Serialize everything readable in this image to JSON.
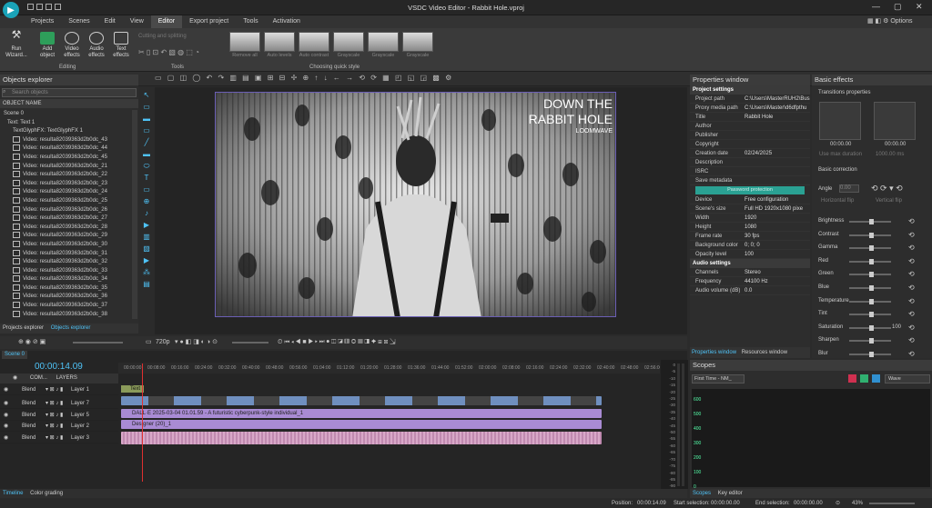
{
  "window": {
    "title": "VSDC Video Editor - Rabbit Hole.vproj",
    "options": "Options"
  },
  "menu": [
    "Projects",
    "Scenes",
    "Edit",
    "View",
    "Editor",
    "Export project",
    "Tools",
    "Activation"
  ],
  "ribbon": {
    "run": "Run Wizard...",
    "add": "Add object",
    "video": "Video effects",
    "audio": "Audio effects",
    "text": "Text effects",
    "editing": "Editing",
    "cutting": "Cutting and splitting",
    "tools": "Tools",
    "choosing": "Choosing quick style",
    "styles": [
      "Remove all",
      "Auto levels",
      "Auto contrast",
      "Grayscale",
      "Grayscale",
      "Grayscale"
    ]
  },
  "objects_explorer": {
    "title": "Objects explorer",
    "search_placeholder": "Search objects",
    "col": "OBJECT NAME",
    "scene": "Scene 0",
    "text": "Text: Text 1",
    "glyph": "TextGlyphFX: TextGlyphFX 1",
    "videos": [
      "Video: resulta82039363d2b0dc_43",
      "Video: resulta82039363d2b0dc_44",
      "Video: resulta82039363d2b0dc_45",
      "Video: resulta82039363d2b0dc_21",
      "Video: resulta82039363d2b0dc_22",
      "Video: resulta82039363d2b0dc_23",
      "Video: resulta82039363d2b0dc_24",
      "Video: resulta82039363d2b0dc_25",
      "Video: resulta82039363d2b0dc_26",
      "Video: resulta82039363d2b0dc_27",
      "Video: resulta82039363d2b0dc_28",
      "Video: resulta82039363d2b0dc_29",
      "Video: resulta82039363d2b0dc_30",
      "Video: resulta82039363d2b0dc_31",
      "Video: resulta82039363d2b0dc_32",
      "Video: resulta82039363d2b0dc_33",
      "Video: resulta82039363d2b0dc_34",
      "Video: resulta82039363d2b0dc_35",
      "Video: resulta82039363d2b0dc_36",
      "Video: resulta82039363d2b0dc_37",
      "Video: resulta82039363d2b0dc_38"
    ],
    "tabs": [
      "Projects explorer",
      "Objects explorer"
    ]
  },
  "preview": {
    "title_line1": "DOWN THE",
    "title_line2": "RABBIT HOLE",
    "brand": "LOOMWAVE",
    "quality": "720p"
  },
  "properties": {
    "title": "Properties window",
    "section": "Project settings",
    "rows": [
      [
        "Project path",
        "C:\\Users\\MasterRUH2\\Busin"
      ],
      [
        "Proxy media path",
        "C:\\Users\\Master\\d6dfpthu"
      ],
      [
        "Title",
        "Rabbit Hole"
      ],
      [
        "Author",
        ""
      ],
      [
        "Publisher",
        ""
      ],
      [
        "Copyright",
        ""
      ],
      [
        "Creation date",
        "02/24/2025"
      ],
      [
        "Description",
        ""
      ],
      [
        "ISRC",
        ""
      ],
      [
        "Save metadata",
        ""
      ]
    ],
    "password": "Password protection",
    "rows2": [
      [
        "Device",
        "Free configuration"
      ],
      [
        "Scene's size",
        "Full HD 1920x1080 pixe"
      ],
      [
        "Width",
        "1920"
      ],
      [
        "Height",
        "1080"
      ],
      [
        "Frame rate",
        "30 fps"
      ],
      [
        "Background color",
        "0; 0; 0"
      ],
      [
        "Opacity level",
        "100"
      ]
    ],
    "audio": "Audio settings",
    "rows3": [
      [
        "Channels",
        "Stereo"
      ],
      [
        "Frequency",
        "44100 Hz"
      ],
      [
        "Audio volume (dB)",
        "0.0"
      ]
    ],
    "tabs": [
      "Properties window",
      "Resources window"
    ]
  },
  "basic_effects": {
    "title": "Basic effects",
    "transitions": "Transitions properties",
    "t1": "00:00.00",
    "t2": "00:00.00",
    "use_max": "Use max duration",
    "max_val": "1000.00 ms",
    "correction": "Basic correction",
    "angle": "Angle",
    "angle_val": "0.00",
    "hflip": "Horizontal flip",
    "vflip": "Vertical flip",
    "items": [
      "Brightness",
      "Contrast",
      "Gamma",
      "Red",
      "Green",
      "Blue",
      "Temperature",
      "Tint",
      "Saturation",
      "Sharpen",
      "Blur"
    ],
    "saturation_val": "100"
  },
  "timeline": {
    "scene_tab": "Scene 0",
    "time": "00:00:14.09",
    "com": "COM...",
    "layers_hdr": "LAYERS",
    "layers": [
      {
        "blend": "Blend",
        "name": "Layer 1"
      },
      {
        "blend": "Blend",
        "name": "Layer 7"
      },
      {
        "blend": "Blend",
        "name": "Layer 5"
      },
      {
        "blend": "Blend",
        "name": "Layer 2"
      },
      {
        "blend": "Blend",
        "name": "Layer 3"
      }
    ],
    "ruler": [
      "00:00:00",
      "00:08:00",
      "00:16:00",
      "00:24:00",
      "00:32:00",
      "00:40:00",
      "00:48:00",
      "00:56:00",
      "01:04:00",
      "01:12:00",
      "01:20:00",
      "01:28:00",
      "01:36:00",
      "01:44:00",
      "01:52:00",
      "02:00:00",
      "02:08:00",
      "02:16:00",
      "02:24:00",
      "02:32:00",
      "02:40:00",
      "02:48:00",
      "02:56:00",
      "03:04:00",
      "03:12:00",
      "03:20:00",
      "03:28:00",
      "03:36:00",
      "03:44:00",
      "03:52:00",
      "04:00:00",
      "04:08:00",
      "04:16:00",
      "04:24:00",
      "04:32:00",
      "04:40:00",
      "04:48:00"
    ],
    "text_clip": "Text",
    "dall_clip": "DALL·E 2025-03-04 01.01.59 - A futuristic cyberpunk-style individual_1",
    "designer_clip": "Designer (20)_1",
    "tabs": [
      "Timeline",
      "Color grading"
    ]
  },
  "scopes": {
    "title": "Scopes",
    "time": "First Time - NM_",
    "wave": "Wave",
    "tabs": [
      "Scopes",
      "Key editor"
    ],
    "axis": [
      "600",
      "500",
      "400",
      "300",
      "200",
      "100",
      "0"
    ]
  },
  "meter": [
    "0",
    "-5",
    "-10",
    "-15",
    "-20",
    "-25",
    "-30",
    "-35",
    "-40",
    "-45",
    "-50",
    "-55",
    "-60",
    "-65",
    "-70",
    "-75",
    "-80",
    "-85",
    "-90"
  ],
  "status": {
    "position_label": "Position:",
    "position": "00:00:14.09",
    "start_label": "Start selection:",
    "start": "00:00:00.00",
    "end_label": "End selection:",
    "end": "00:00:00.00",
    "zoom": "43%"
  }
}
